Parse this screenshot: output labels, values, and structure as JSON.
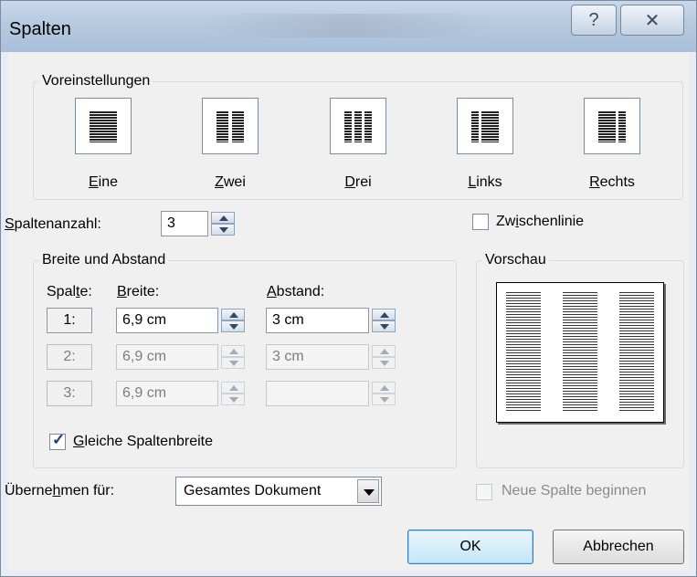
{
  "window": {
    "title": "Spalten",
    "help_glyph": "?",
    "close_glyph": "✕"
  },
  "presets": {
    "label": "Voreinstellungen",
    "items": [
      {
        "key": "E",
        "rest": "ine"
      },
      {
        "key": "Z",
        "rest": "wei"
      },
      {
        "key": "D",
        "rest": "rei"
      },
      {
        "key": "L",
        "rest": "inks"
      },
      {
        "key": "R",
        "rest": "echts"
      }
    ]
  },
  "column_count": {
    "key": "S",
    "rest": "paltenanzahl:",
    "value": "3"
  },
  "separator": {
    "pre": "Zw",
    "key": "i",
    "post": "schenlinie",
    "checked": false
  },
  "width_spacing": {
    "label": "Breite und Abstand",
    "col_header_pre": "Spal",
    "col_header_key": "t",
    "col_header_post": "e:",
    "width_header_key": "B",
    "width_header_rest": "reite:",
    "spacing_header_key": "A",
    "spacing_header_rest": "bstand:",
    "rows": [
      {
        "num": "1:",
        "width": "6,9 cm",
        "spacing": "3 cm",
        "enabled": true
      },
      {
        "num": "2:",
        "width": "6,9 cm",
        "spacing": "3 cm",
        "enabled": false
      },
      {
        "num": "3:",
        "width": "6,9 cm",
        "spacing": "",
        "enabled": false
      }
    ],
    "equal_width": {
      "key": "G",
      "rest": "leiche Spaltenbreite",
      "checked": true
    }
  },
  "preview": {
    "label": "Vorschau",
    "columns": 3
  },
  "apply_to": {
    "pre": "Überne",
    "key": "h",
    "post": "men für:",
    "value": "Gesamtes Dokument"
  },
  "new_column": {
    "label": "Neue Spalte beginnen",
    "checked": false,
    "enabled": false
  },
  "buttons": {
    "ok": "OK",
    "cancel": "Abbrechen"
  }
}
